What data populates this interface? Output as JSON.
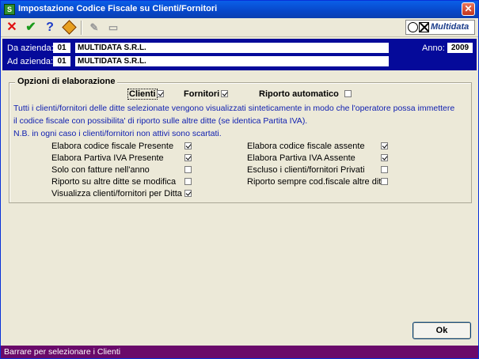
{
  "window": {
    "title": "Impostazione Codice Fiscale su Clienti/Fornitori",
    "icon": "app-icon",
    "close_icon": "close-icon"
  },
  "toolbar": {
    "cancel_icon": "x-icon",
    "confirm_icon": "checkmark-icon",
    "help_icon": "question-icon",
    "tool_icon": "diamond-tool-icon",
    "edit_icon": "notepad-icon",
    "screen_icon": "monitor-icon",
    "brand": "Multidata"
  },
  "header": {
    "da_azienda": {
      "label": "Da azienda:",
      "code": "01",
      "name": "MULTIDATA S.R.L."
    },
    "ad_azienda": {
      "label": "Ad azienda:",
      "code": "01",
      "name": "MULTIDATA S.R.L."
    },
    "anno": {
      "label": "Anno:",
      "value": "2009"
    }
  },
  "options": {
    "title": "Opzioni di elaborazione",
    "top": [
      {
        "label": "Clienti",
        "checked": true
      },
      {
        "label": "Fornitori",
        "checked": true
      },
      {
        "label": "Riporto automatico",
        "checked": false
      }
    ],
    "info": [
      "Tutti i clienti/fornitori delle ditte selezionate vengono visualizzati sinteticamente in modo che l'operatore possa immettere",
      "il codice fiscale con possibilita' di riporto sulle altre ditte (se identica Partita IVA).",
      "N.B. in ogni caso i clienti/fornitori non attivi sono scartati."
    ],
    "left": [
      {
        "label": "Elabora codice fiscale Presente",
        "checked": true
      },
      {
        "label": "Elabora Partiva IVA Presente",
        "checked": true
      },
      {
        "label": "Solo con fatture nell'anno",
        "checked": false
      },
      {
        "label": "Riporto su altre ditte se modifica",
        "checked": false
      },
      {
        "label": "Visualizza clienti/fornitori per Ditta",
        "checked": true
      }
    ],
    "right": [
      {
        "label": "Elabora codice fiscale assente",
        "checked": true
      },
      {
        "label": "Elabora Partiva IVA Assente",
        "checked": true
      },
      {
        "label": "Escluso i clienti/fornitori Privati",
        "checked": false
      },
      {
        "label": "Riporto sempre cod.fiscale altre ditte",
        "checked": false
      }
    ]
  },
  "ok_label": "Ok",
  "status": "Barrare per selezionare i Clienti"
}
